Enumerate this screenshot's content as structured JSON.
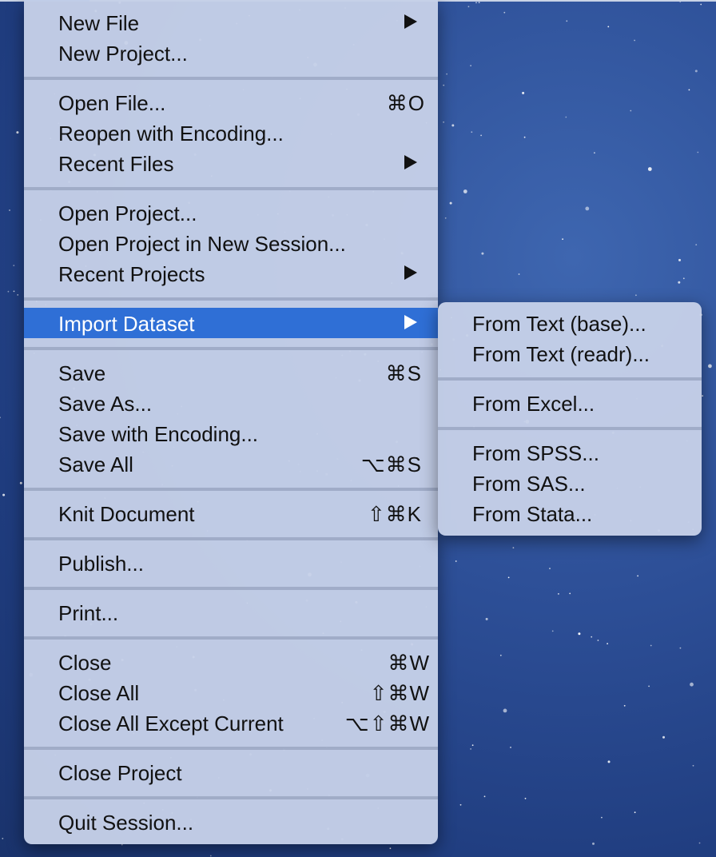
{
  "main_menu": {
    "items": [
      {
        "label": "New File",
        "shortcut": "",
        "submenu": true
      },
      {
        "label": "New Project...",
        "shortcut": "",
        "submenu": false
      },
      {
        "label": "Open File...",
        "shortcut": "⌘O",
        "submenu": false
      },
      {
        "label": "Reopen with Encoding...",
        "shortcut": "",
        "submenu": false
      },
      {
        "label": "Recent Files",
        "shortcut": "",
        "submenu": true
      },
      {
        "label": "Open Project...",
        "shortcut": "",
        "submenu": false
      },
      {
        "label": "Open Project in New Session...",
        "shortcut": "",
        "submenu": false
      },
      {
        "label": "Recent Projects",
        "shortcut": "",
        "submenu": true
      },
      {
        "label": "Import Dataset",
        "shortcut": "",
        "submenu": true,
        "selected": true
      },
      {
        "label": "Save",
        "shortcut": "⌘S",
        "submenu": false
      },
      {
        "label": "Save As...",
        "shortcut": "",
        "submenu": false
      },
      {
        "label": "Save with Encoding...",
        "shortcut": "",
        "submenu": false
      },
      {
        "label": "Save All",
        "shortcut": "⌥⌘S",
        "submenu": false
      },
      {
        "label": "Knit Document",
        "shortcut": "⇧⌘K",
        "submenu": false
      },
      {
        "label": "Publish...",
        "shortcut": "",
        "submenu": false
      },
      {
        "label": "Print...",
        "shortcut": "",
        "submenu": false
      },
      {
        "label": "Close",
        "shortcut": "⌘W",
        "submenu": false
      },
      {
        "label": "Close All",
        "shortcut": "⇧⌘W",
        "submenu": false
      },
      {
        "label": "Close All Except Current",
        "shortcut": "⌥⇧⌘W",
        "submenu": false
      },
      {
        "label": "Close Project",
        "shortcut": "",
        "submenu": false
      },
      {
        "label": "Quit Session...",
        "shortcut": "",
        "submenu": false
      }
    ]
  },
  "import_submenu": {
    "items": [
      {
        "label": "From Text (base)..."
      },
      {
        "label": "From Text (readr)..."
      },
      {
        "label": "From Excel..."
      },
      {
        "label": "From SPSS..."
      },
      {
        "label": "From SAS..."
      },
      {
        "label": "From Stata..."
      }
    ]
  },
  "colors": {
    "menu_bg": "#c6d0e8",
    "selection": "#2f6fd6",
    "desktop": "#2d4f97"
  },
  "icons": {
    "submenu_arrow": "triangle-right-icon"
  }
}
